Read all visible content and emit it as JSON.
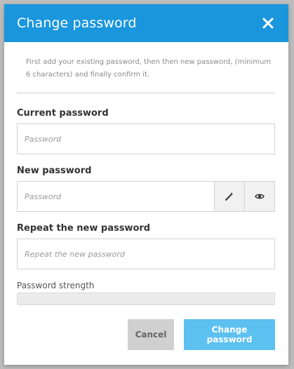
{
  "modal": {
    "title": "Change password",
    "intro_text": "First add your existing password, then then new password, (mínimum 6 characters) and finally confirm it.",
    "fields": {
      "current": {
        "label": "Current password",
        "placeholder": "Password",
        "value": ""
      },
      "new": {
        "label": "New password",
        "placeholder": "Password",
        "value": ""
      },
      "repeat": {
        "label": "Repeat the new password",
        "placeholder": "Repeat the new password",
        "value": ""
      }
    },
    "strength": {
      "label": "Password strength",
      "level": 0
    },
    "buttons": {
      "cancel": "Cancel",
      "submit": "Change password"
    }
  },
  "icons": {
    "close": "close-icon",
    "generate": "magic-wand-icon",
    "reveal": "eye-icon"
  },
  "colors": {
    "header": "#1a96dc",
    "primary_button": "#5cc0f0",
    "cancel_button": "#d0d0d0"
  }
}
